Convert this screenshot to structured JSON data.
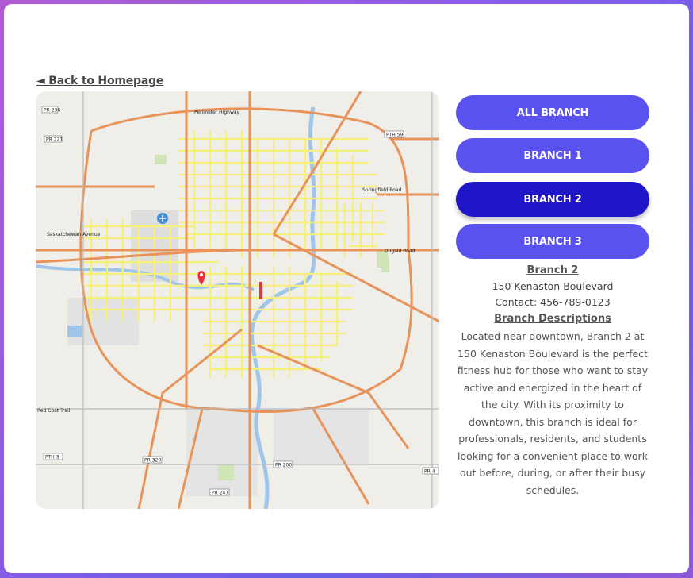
{
  "nav": {
    "back_label": "◄ Back to Homepage"
  },
  "branches": {
    "all": "ALL BRANCH",
    "b1": "BRANCH 1",
    "b2": "BRANCH 2",
    "b3": "BRANCH 3",
    "active": "BRANCH 2"
  },
  "details": {
    "name": "Branch 2",
    "address": "150 Kenaston Boulevard",
    "contact": "Contact: 456-789-0123",
    "desc_heading": "Branch Descriptions",
    "description": "Located near downtown, Branch 2 at 150 Kenaston Boulevard is the perfect fitness hub for those who want to stay active and energized in the heart of the city. With its proximity to downtown, this branch is ideal for professionals, residents, and students looking for a convenient place to work out before, during, or after their busy schedules."
  },
  "map": {
    "labels": {
      "pr236": "PR 236",
      "pr221": "PR 221",
      "pth59": "PTH 59",
      "pr320": "PR 320",
      "pr200": "PR 200",
      "pr247": "PR 247",
      "pth3": "PTH 3",
      "pr4": "PR 4",
      "perimeter": "Perimeter Highway",
      "springfield": "Springfield Road",
      "dugald": "Dugald Road",
      "redcoat": "Red Coat Trail",
      "saskatchewan": "Saskatchewan Avenue"
    },
    "colors": {
      "major_road": "#e8935a",
      "street": "#f6ef7a",
      "water": "#9fc6e8",
      "land": "#efeee9",
      "park": "#cfe5b8",
      "marker": "#e8323c"
    }
  }
}
